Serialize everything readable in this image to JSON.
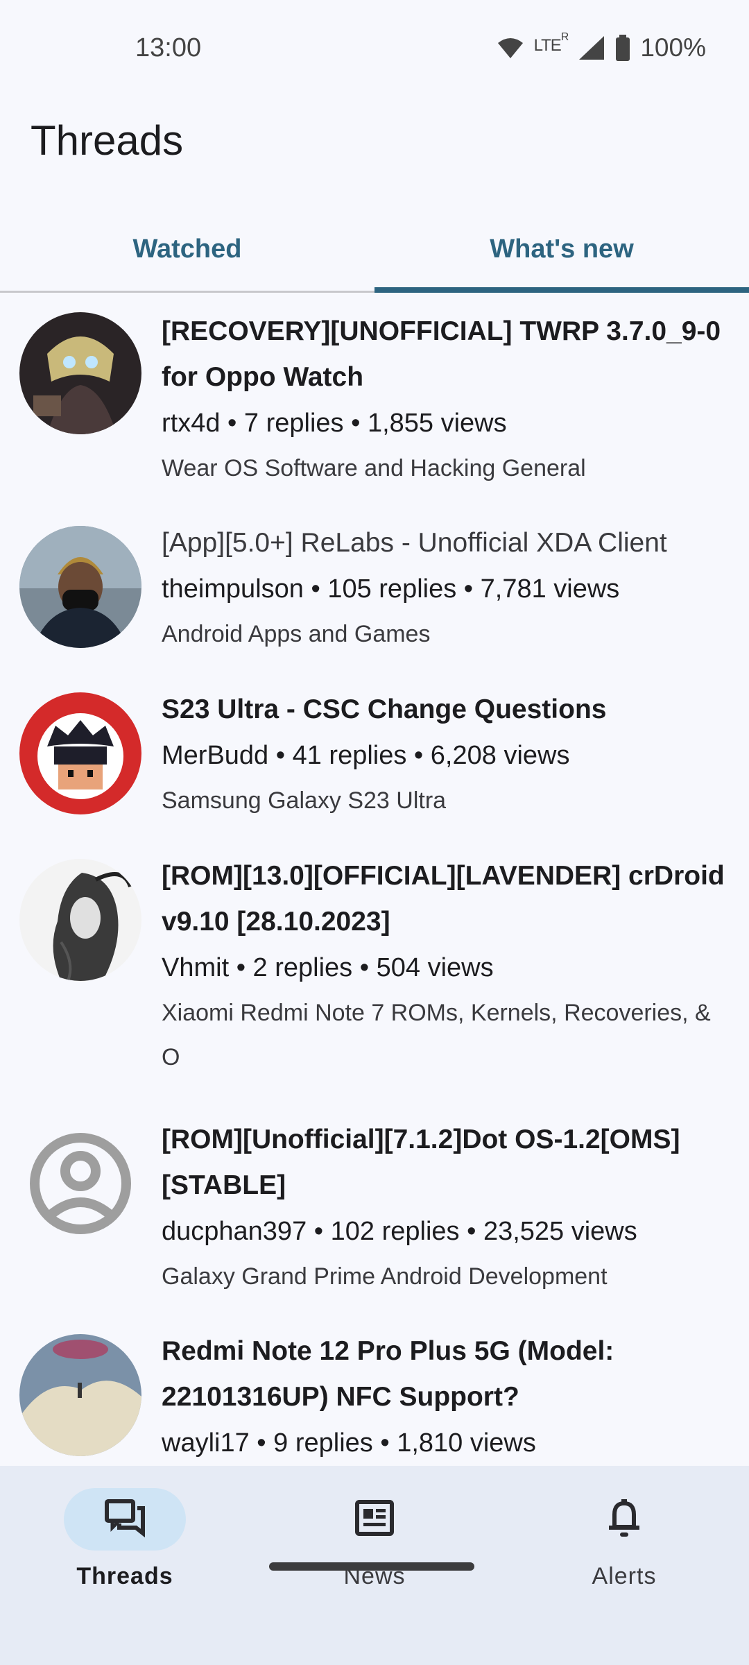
{
  "status_bar": {
    "time": "13:00",
    "network": "LTE",
    "roaming": "R",
    "battery": "100%"
  },
  "page": {
    "title": "Threads"
  },
  "tabs": [
    {
      "label": "Watched",
      "active": false
    },
    {
      "label": "What's new",
      "active": true
    }
  ],
  "threads": [
    {
      "title": "[RECOVERY][UNOFFICIAL] TWRP 3.7.0_9-0 for Oppo Watch",
      "meta": "rtx4d • 7 replies • 1,855 views",
      "forum": "Wear OS Software and Hacking General",
      "read": false
    },
    {
      "title": "[App][5.0+] ReLabs - Unofficial XDA Client",
      "meta": "theimpulson • 105 replies • 7,781 views",
      "forum": "Android Apps and Games",
      "read": true
    },
    {
      "title": "S23 Ultra - CSC Change Questions",
      "meta": "MerBudd • 41 replies • 6,208 views",
      "forum": "Samsung Galaxy S23 Ultra",
      "read": false
    },
    {
      "title": "[ROM][13.0][OFFICIAL][LAVENDER] crDroid v9.10 [28.10.2023]",
      "meta": "Vhmit • 2 replies • 504 views",
      "forum": "Xiaomi Redmi Note 7 ROMs, Kernels, Recoveries, & O",
      "read": false
    },
    {
      "title": "[ROM][Unofficial][7.1.2]Dot OS-1.2[OMS][STABLE]",
      "meta": "ducphan397 • 102 replies • 23,525 views",
      "forum": "Galaxy Grand Prime Android Development",
      "read": false
    },
    {
      "title": "Redmi Note 12 Pro Plus 5G (Model: 22101316UP) NFC Support?",
      "meta": "wayli17 • 9 replies • 1,810 views",
      "forum": "",
      "read": false
    }
  ],
  "bottom_nav": [
    {
      "label": "Threads",
      "icon": "forum-icon",
      "active": true
    },
    {
      "label": "News",
      "icon": "newspaper-icon",
      "active": false
    },
    {
      "label": "Alerts",
      "icon": "bell-icon",
      "active": false
    }
  ],
  "colors": {
    "accent": "#2d6480",
    "background": "#f7f8fd",
    "nav_background": "#e6ebf5",
    "nav_active_pill": "#cfe4f5"
  }
}
